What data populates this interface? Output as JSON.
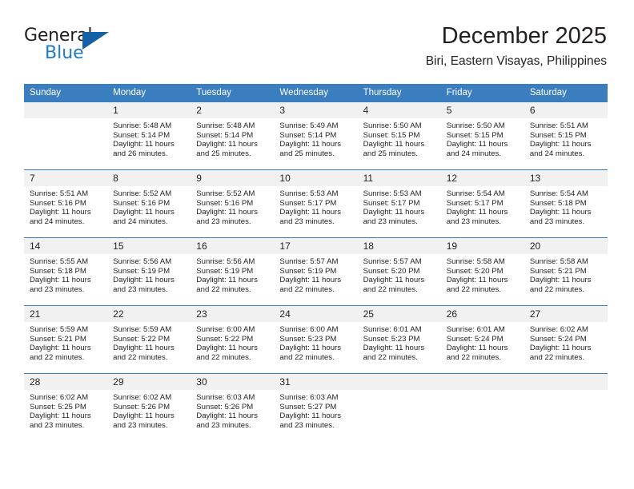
{
  "brand": {
    "name_part1": "General",
    "name_part2": "Blue",
    "accent_color": "#1461a8",
    "text_color": "#1f7cc4"
  },
  "header": {
    "title": "December 2025",
    "subtitle": "Biri, Eastern Visayas, Philippines"
  },
  "calendar": {
    "header_bg": "#3a7ebf",
    "daynum_bg": "#f1f1f1",
    "weekday_headers": [
      "Sunday",
      "Monday",
      "Tuesday",
      "Wednesday",
      "Thursday",
      "Friday",
      "Saturday"
    ],
    "weeks": [
      [
        {
          "day": "",
          "sunrise": "",
          "sunset": "",
          "daylight1": "",
          "daylight2": ""
        },
        {
          "day": "1",
          "sunrise": "Sunrise: 5:48 AM",
          "sunset": "Sunset: 5:14 PM",
          "daylight1": "Daylight: 11 hours",
          "daylight2": "and 26 minutes."
        },
        {
          "day": "2",
          "sunrise": "Sunrise: 5:48 AM",
          "sunset": "Sunset: 5:14 PM",
          "daylight1": "Daylight: 11 hours",
          "daylight2": "and 25 minutes."
        },
        {
          "day": "3",
          "sunrise": "Sunrise: 5:49 AM",
          "sunset": "Sunset: 5:14 PM",
          "daylight1": "Daylight: 11 hours",
          "daylight2": "and 25 minutes."
        },
        {
          "day": "4",
          "sunrise": "Sunrise: 5:50 AM",
          "sunset": "Sunset: 5:15 PM",
          "daylight1": "Daylight: 11 hours",
          "daylight2": "and 25 minutes."
        },
        {
          "day": "5",
          "sunrise": "Sunrise: 5:50 AM",
          "sunset": "Sunset: 5:15 PM",
          "daylight1": "Daylight: 11 hours",
          "daylight2": "and 24 minutes."
        },
        {
          "day": "6",
          "sunrise": "Sunrise: 5:51 AM",
          "sunset": "Sunset: 5:15 PM",
          "daylight1": "Daylight: 11 hours",
          "daylight2": "and 24 minutes."
        }
      ],
      [
        {
          "day": "7",
          "sunrise": "Sunrise: 5:51 AM",
          "sunset": "Sunset: 5:16 PM",
          "daylight1": "Daylight: 11 hours",
          "daylight2": "and 24 minutes."
        },
        {
          "day": "8",
          "sunrise": "Sunrise: 5:52 AM",
          "sunset": "Sunset: 5:16 PM",
          "daylight1": "Daylight: 11 hours",
          "daylight2": "and 24 minutes."
        },
        {
          "day": "9",
          "sunrise": "Sunrise: 5:52 AM",
          "sunset": "Sunset: 5:16 PM",
          "daylight1": "Daylight: 11 hours",
          "daylight2": "and 23 minutes."
        },
        {
          "day": "10",
          "sunrise": "Sunrise: 5:53 AM",
          "sunset": "Sunset: 5:17 PM",
          "daylight1": "Daylight: 11 hours",
          "daylight2": "and 23 minutes."
        },
        {
          "day": "11",
          "sunrise": "Sunrise: 5:53 AM",
          "sunset": "Sunset: 5:17 PM",
          "daylight1": "Daylight: 11 hours",
          "daylight2": "and 23 minutes."
        },
        {
          "day": "12",
          "sunrise": "Sunrise: 5:54 AM",
          "sunset": "Sunset: 5:17 PM",
          "daylight1": "Daylight: 11 hours",
          "daylight2": "and 23 minutes."
        },
        {
          "day": "13",
          "sunrise": "Sunrise: 5:54 AM",
          "sunset": "Sunset: 5:18 PM",
          "daylight1": "Daylight: 11 hours",
          "daylight2": "and 23 minutes."
        }
      ],
      [
        {
          "day": "14",
          "sunrise": "Sunrise: 5:55 AM",
          "sunset": "Sunset: 5:18 PM",
          "daylight1": "Daylight: 11 hours",
          "daylight2": "and 23 minutes."
        },
        {
          "day": "15",
          "sunrise": "Sunrise: 5:56 AM",
          "sunset": "Sunset: 5:19 PM",
          "daylight1": "Daylight: 11 hours",
          "daylight2": "and 23 minutes."
        },
        {
          "day": "16",
          "sunrise": "Sunrise: 5:56 AM",
          "sunset": "Sunset: 5:19 PM",
          "daylight1": "Daylight: 11 hours",
          "daylight2": "and 22 minutes."
        },
        {
          "day": "17",
          "sunrise": "Sunrise: 5:57 AM",
          "sunset": "Sunset: 5:19 PM",
          "daylight1": "Daylight: 11 hours",
          "daylight2": "and 22 minutes."
        },
        {
          "day": "18",
          "sunrise": "Sunrise: 5:57 AM",
          "sunset": "Sunset: 5:20 PM",
          "daylight1": "Daylight: 11 hours",
          "daylight2": "and 22 minutes."
        },
        {
          "day": "19",
          "sunrise": "Sunrise: 5:58 AM",
          "sunset": "Sunset: 5:20 PM",
          "daylight1": "Daylight: 11 hours",
          "daylight2": "and 22 minutes."
        },
        {
          "day": "20",
          "sunrise": "Sunrise: 5:58 AM",
          "sunset": "Sunset: 5:21 PM",
          "daylight1": "Daylight: 11 hours",
          "daylight2": "and 22 minutes."
        }
      ],
      [
        {
          "day": "21",
          "sunrise": "Sunrise: 5:59 AM",
          "sunset": "Sunset: 5:21 PM",
          "daylight1": "Daylight: 11 hours",
          "daylight2": "and 22 minutes."
        },
        {
          "day": "22",
          "sunrise": "Sunrise: 5:59 AM",
          "sunset": "Sunset: 5:22 PM",
          "daylight1": "Daylight: 11 hours",
          "daylight2": "and 22 minutes."
        },
        {
          "day": "23",
          "sunrise": "Sunrise: 6:00 AM",
          "sunset": "Sunset: 5:22 PM",
          "daylight1": "Daylight: 11 hours",
          "daylight2": "and 22 minutes."
        },
        {
          "day": "24",
          "sunrise": "Sunrise: 6:00 AM",
          "sunset": "Sunset: 5:23 PM",
          "daylight1": "Daylight: 11 hours",
          "daylight2": "and 22 minutes."
        },
        {
          "day": "25",
          "sunrise": "Sunrise: 6:01 AM",
          "sunset": "Sunset: 5:23 PM",
          "daylight1": "Daylight: 11 hours",
          "daylight2": "and 22 minutes."
        },
        {
          "day": "26",
          "sunrise": "Sunrise: 6:01 AM",
          "sunset": "Sunset: 5:24 PM",
          "daylight1": "Daylight: 11 hours",
          "daylight2": "and 22 minutes."
        },
        {
          "day": "27",
          "sunrise": "Sunrise: 6:02 AM",
          "sunset": "Sunset: 5:24 PM",
          "daylight1": "Daylight: 11 hours",
          "daylight2": "and 22 minutes."
        }
      ],
      [
        {
          "day": "28",
          "sunrise": "Sunrise: 6:02 AM",
          "sunset": "Sunset: 5:25 PM",
          "daylight1": "Daylight: 11 hours",
          "daylight2": "and 23 minutes."
        },
        {
          "day": "29",
          "sunrise": "Sunrise: 6:02 AM",
          "sunset": "Sunset: 5:26 PM",
          "daylight1": "Daylight: 11 hours",
          "daylight2": "and 23 minutes."
        },
        {
          "day": "30",
          "sunrise": "Sunrise: 6:03 AM",
          "sunset": "Sunset: 5:26 PM",
          "daylight1": "Daylight: 11 hours",
          "daylight2": "and 23 minutes."
        },
        {
          "day": "31",
          "sunrise": "Sunrise: 6:03 AM",
          "sunset": "Sunset: 5:27 PM",
          "daylight1": "Daylight: 11 hours",
          "daylight2": "and 23 minutes."
        },
        {
          "day": "",
          "sunrise": "",
          "sunset": "",
          "daylight1": "",
          "daylight2": ""
        },
        {
          "day": "",
          "sunrise": "",
          "sunset": "",
          "daylight1": "",
          "daylight2": ""
        },
        {
          "day": "",
          "sunrise": "",
          "sunset": "",
          "daylight1": "",
          "daylight2": ""
        }
      ]
    ]
  }
}
